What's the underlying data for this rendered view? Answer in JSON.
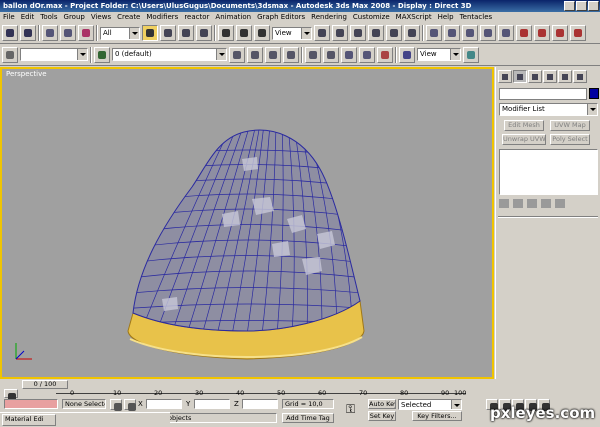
{
  "titlebar": {
    "text": "ballon dOr.max    - Project Folder: C:\\Users\\UlusGugus\\Documents\\3dsmax    - Autodesk 3ds Max 2008    - Display : Direct 3D"
  },
  "menu": [
    "File",
    "Edit",
    "Tools",
    "Group",
    "Views",
    "Create",
    "Modifiers",
    "reactor",
    "Animation",
    "Graph Editors",
    "Rendering",
    "Customize",
    "MAXScript",
    "Help",
    "Tentacles"
  ],
  "toolbar1": {
    "selection_filter": "All",
    "ref_coord": "View"
  },
  "toolbar2": {
    "layer": "0 (default)",
    "view_dropdown": "View"
  },
  "viewport": {
    "label": "Perspective"
  },
  "command_panel": {
    "modifier_list": "Modifier List",
    "buttons": [
      "Edit Mesh",
      "UVW Map",
      "Unwrap UVW",
      "Poly Select"
    ]
  },
  "time_slider": {
    "value": "0 / 100"
  },
  "trackbar": {
    "ticks": [
      "0",
      "10",
      "20",
      "30",
      "40",
      "50",
      "60",
      "70",
      "80",
      "90",
      "100"
    ]
  },
  "status": {
    "selection": "None Selecte",
    "x_label": "X",
    "y_label": "Y",
    "z_label": "Z",
    "grid": "Grid = 10,0",
    "auto_key": "Auto Key",
    "auto_key_value": "Selected",
    "set_key": "Set Key",
    "key_filters": "Key Filters...",
    "prompt": "ick-and-drag to select objects",
    "add_time_tag": "Add Time Tag",
    "taskbar_item": "Material Edi"
  },
  "watermark": "pxleyes.com",
  "colors": {
    "accent": "#f0c400",
    "viewport_bg": "#a0a0a0",
    "wire": "#2a2aa0",
    "object_color": "#0000a0"
  }
}
